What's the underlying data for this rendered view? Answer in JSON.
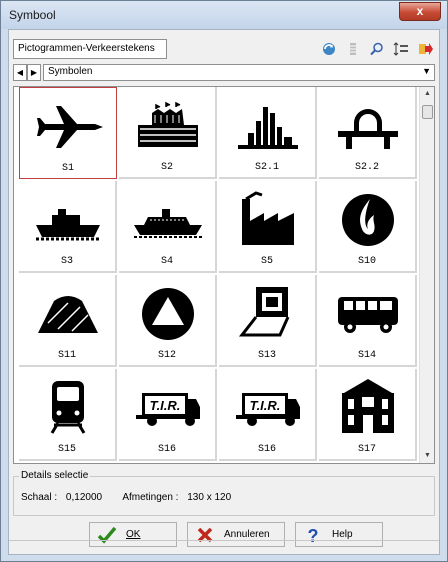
{
  "window": {
    "title": "Symbool",
    "close_glyph": "x"
  },
  "toolbar": {
    "category": "Pictogrammen-Verkeerstekens",
    "tools": [
      "refresh-icon",
      "list-icon",
      "zoom-icon",
      "spacing-icon",
      "export-icon"
    ]
  },
  "navigation": {
    "prev_glyph": "◀",
    "next_glyph": "▶",
    "selected_set": "Symbolen",
    "dropdown_glyph": "▼"
  },
  "symbols": [
    {
      "label": "S1",
      "icon": "airplane-icon",
      "selected": true
    },
    {
      "label": "S2",
      "icon": "stadium-icon"
    },
    {
      "label": "S2.1",
      "icon": "city-skyline-icon"
    },
    {
      "label": "S2.2",
      "icon": "arch-bridge-icon"
    },
    {
      "label": "S3",
      "icon": "cargo-ship-icon"
    },
    {
      "label": "S4",
      "icon": "passenger-ship-icon"
    },
    {
      "label": "S5",
      "icon": "factory-icon"
    },
    {
      "label": "S10",
      "icon": "flame-icon"
    },
    {
      "label": "S11",
      "icon": "hill-icon"
    },
    {
      "label": "S12",
      "icon": "warning-circle-icon"
    },
    {
      "label": "S13",
      "icon": "computer-icon"
    },
    {
      "label": "S14",
      "icon": "bus-icon"
    },
    {
      "label": "S15",
      "icon": "train-icon"
    },
    {
      "label": "S16",
      "icon": "tir-truck-icon"
    },
    {
      "label": "S16",
      "icon": "tir-truck-icon"
    },
    {
      "label": "S17",
      "icon": "building-icon"
    }
  ],
  "details": {
    "legend": "Details selectie",
    "scale_label": "Schaal :",
    "scale_value": "0,12000",
    "size_label": "Afmetingen :",
    "size_value": "130 x 120"
  },
  "buttons": {
    "ok": "OK",
    "cancel": "Annuleren",
    "help": "Help"
  },
  "colors": {
    "ok_check": "#2f8a1d",
    "cancel_x": "#c0281c",
    "help_q": "#1f4fb0"
  }
}
